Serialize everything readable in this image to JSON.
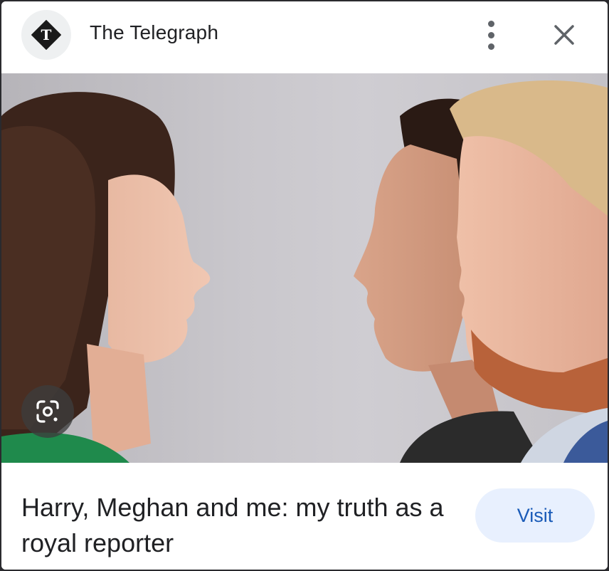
{
  "header": {
    "source_name": "The Telegraph",
    "logo_icon": "telegraph-t-logo-icon",
    "more_icon": "more-vertical-icon",
    "close_icon": "close-icon"
  },
  "image": {
    "lens_icon": "google-lens-icon"
  },
  "footer": {
    "headline": "Harry, Meghan and me: my truth as a royal reporter",
    "visit_label": "Visit"
  },
  "colors": {
    "visit_bg": "#e8f0fe",
    "visit_text": "#1a5bb8",
    "text_primary": "#202124"
  }
}
